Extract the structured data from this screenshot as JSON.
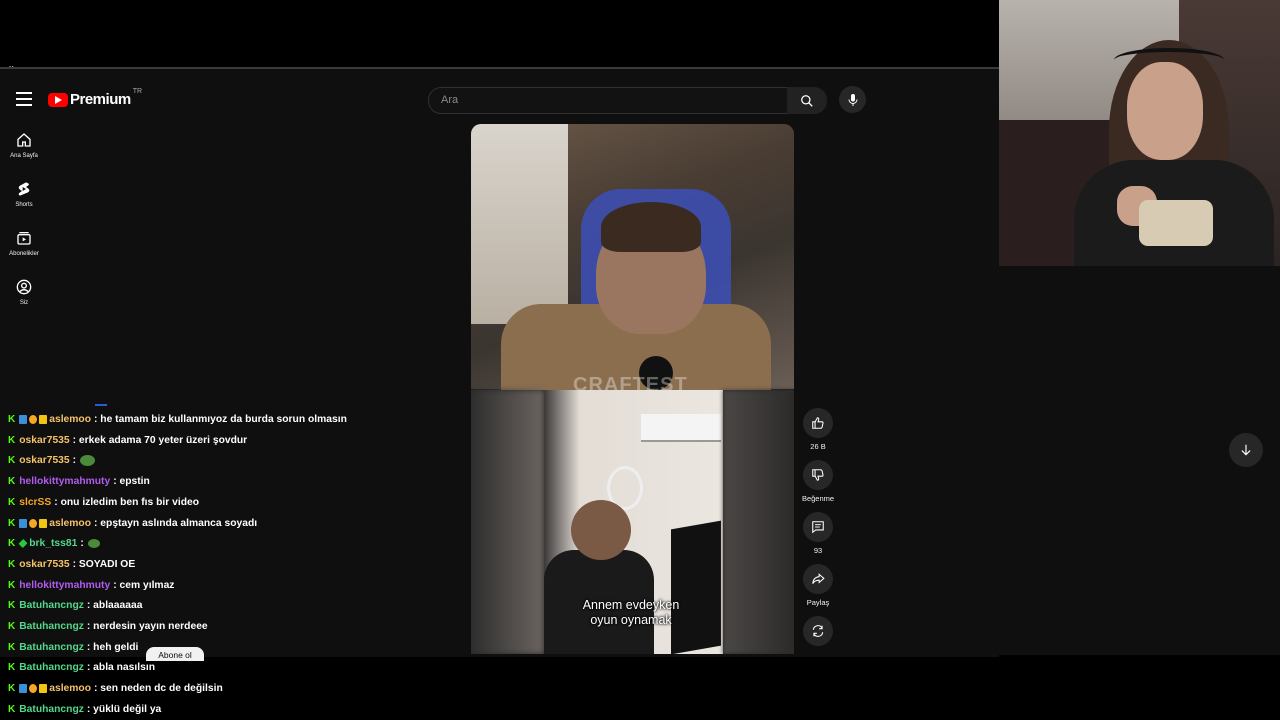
{
  "youtube": {
    "logo_text": "Premium",
    "logo_region": "TR",
    "search_placeholder": "Ara",
    "nav": [
      {
        "label": "Ana Sayfa",
        "icon": "home-icon"
      },
      {
        "label": "Shorts",
        "icon": "shorts-icon"
      },
      {
        "label": "Abonelikler",
        "icon": "subscriptions-icon"
      },
      {
        "label": "Siz",
        "icon": "account-icon"
      }
    ],
    "short": {
      "watermark": "CRAFTEST",
      "caption_line1": "Annem evdeyken",
      "caption_line2": "oyun oynamak"
    },
    "actions": {
      "like_count": "26 B",
      "dislike_label": "Beğenme",
      "comment_count": "93",
      "share_label": "Paylaş"
    },
    "subscribe_label": "Abone ol"
  },
  "chat": [
    {
      "user": "aslemoo",
      "color": "#f5c26b",
      "badges": [
        "k",
        "blue",
        "orange",
        "yellow"
      ],
      "message": ": he tamam biz kullanmıyoz da burda sorun olmasın",
      "emote": false
    },
    {
      "user": "oskar7535",
      "color": "#f5c26b",
      "badges": [
        "k"
      ],
      "message": ": erkek adama 70 yeter üzeri şovdur",
      "emote": false
    },
    {
      "user": "oskar7535",
      "color": "#f5c26b",
      "badges": [
        "k"
      ],
      "message": ":",
      "emote": true
    },
    {
      "user": "hellokittymahmuty",
      "color": "#b05cf0",
      "badges": [
        "k"
      ],
      "message": ": epstin",
      "emote": false
    },
    {
      "user": "slcrSS",
      "color": "#f5a623",
      "badges": [
        "k"
      ],
      "message": ": onu izledim ben fıs bir video",
      "emote": false
    },
    {
      "user": "aslemoo",
      "color": "#f5c26b",
      "badges": [
        "k",
        "blue",
        "orange",
        "yellow"
      ],
      "message": ": epştayn aslında almanca soyadı",
      "emote": false
    },
    {
      "user": "brk_tss81",
      "color": "#53d88a",
      "badges": [
        "k",
        "green"
      ],
      "message": ":",
      "emote": true
    },
    {
      "user": "oskar7535",
      "color": "#f5c26b",
      "badges": [
        "k"
      ],
      "message": ": SOYADI OE",
      "emote": false
    },
    {
      "user": "hellokittymahmuty",
      "color": "#b05cf0",
      "badges": [
        "k"
      ],
      "message": ": cem yılmaz",
      "emote": false
    },
    {
      "user": "Batuhancngz",
      "color": "#53d88a",
      "badges": [
        "k"
      ],
      "message": ": ablaaaaaa",
      "emote": false
    },
    {
      "user": "Batuhancngz",
      "color": "#53d88a",
      "badges": [
        "k"
      ],
      "message": ": nerdesin yayın nerdeee",
      "emote": false
    },
    {
      "user": "Batuhancngz",
      "color": "#53d88a",
      "badges": [
        "k"
      ],
      "message": ": heh geldi",
      "emote": false
    },
    {
      "user": "Batuhancngz",
      "color": "#53d88a",
      "badges": [
        "k"
      ],
      "message": ": abla nasılsın",
      "emote": false
    },
    {
      "user": "aslemoo",
      "color": "#f5c26b",
      "badges": [
        "k",
        "blue",
        "orange",
        "yellow"
      ],
      "message": ": sen neden dc de değilsin",
      "emote": false
    },
    {
      "user": "Batuhancngz",
      "color": "#53d88a",
      "badges": [
        "k"
      ],
      "message": ": yüklü değil ya",
      "emote": false
    }
  ]
}
